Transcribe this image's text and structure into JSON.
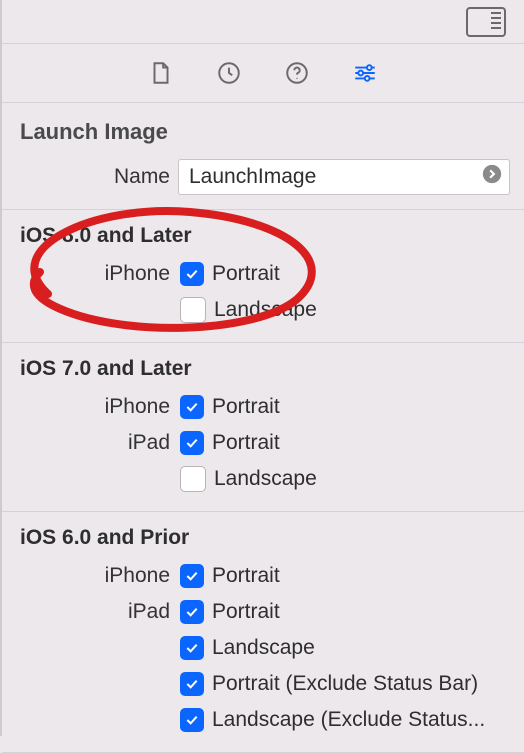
{
  "header": {
    "title": "Launch Image"
  },
  "name_row": {
    "label": "Name",
    "value": "LaunchImage"
  },
  "tabs": {
    "file": "file-icon",
    "history": "history-icon",
    "help": "help-icon",
    "settings": "settings-icon"
  },
  "groups": [
    {
      "title": "iOS 8.0 and Later",
      "rows": [
        {
          "device": "iPhone",
          "option": "Portrait",
          "checked": true
        },
        {
          "device": "",
          "option": "Landscape",
          "checked": false
        }
      ]
    },
    {
      "title": "iOS 7.0 and Later",
      "rows": [
        {
          "device": "iPhone",
          "option": "Portrait",
          "checked": true
        },
        {
          "device": "iPad",
          "option": "Portrait",
          "checked": true
        },
        {
          "device": "",
          "option": "Landscape",
          "checked": false
        }
      ]
    },
    {
      "title": "iOS 6.0 and Prior",
      "rows": [
        {
          "device": "iPhone",
          "option": "Portrait",
          "checked": true
        },
        {
          "device": "iPad",
          "option": "Portrait",
          "checked": true
        },
        {
          "device": "",
          "option": "Landscape",
          "checked": true
        },
        {
          "device": "",
          "option": "Portrait (Exclude Status Bar)",
          "checked": true
        },
        {
          "device": "",
          "option": "Landscape (Exclude Status...",
          "checked": true
        }
      ]
    }
  ],
  "annotation": {
    "stroke": "#d81e1e"
  }
}
